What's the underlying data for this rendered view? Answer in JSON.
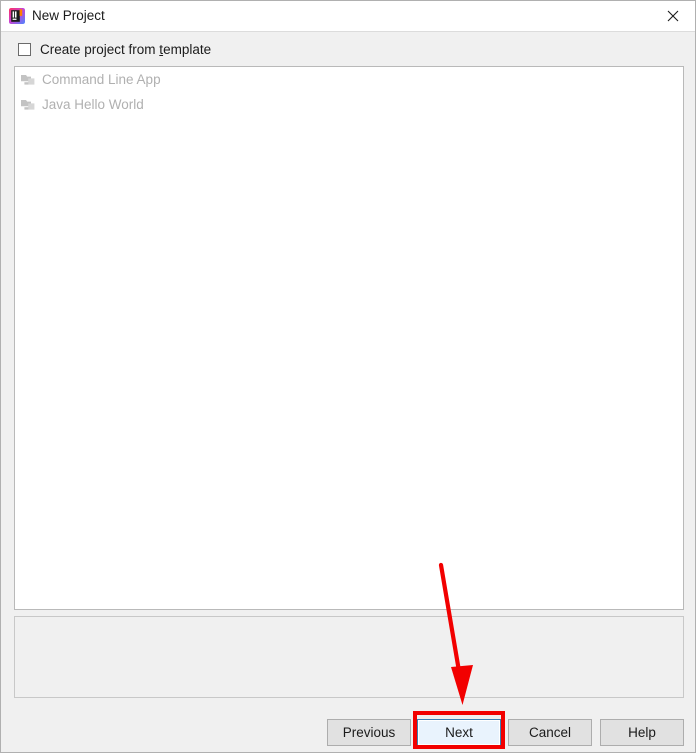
{
  "window": {
    "title": "New Project",
    "app_icon": "intellij-idea-icon",
    "close_icon": "close-icon"
  },
  "header": {
    "checkbox_label_before": "Create project from ",
    "checkbox_mnemonic": "t",
    "checkbox_label_after": "emplate",
    "checkbox_checked": false
  },
  "template_list": {
    "items": [
      {
        "label": "Command Line App",
        "icon": "folder-module-icon",
        "disabled": true
      },
      {
        "label": "Java Hello World",
        "icon": "folder-module-icon",
        "disabled": true
      }
    ]
  },
  "description_panel": {
    "text": ""
  },
  "buttons": {
    "previous": "Previous",
    "next": "Next",
    "cancel": "Cancel",
    "help": "Help"
  },
  "annotations": {
    "highlight_target": "next-button",
    "arrow_color": "#f20000",
    "rect_color": "#f20000"
  },
  "colors": {
    "titlebar_bg": "#ffffff",
    "dialog_bg": "#f0f0f0",
    "list_bg": "#ffffff",
    "disabled_text": "#b0b0b0",
    "text": "#1b1b1b",
    "focus_border": "#3c7fb1",
    "focus_fill": "#e9f3fd",
    "annotation_red": "#f20000"
  }
}
